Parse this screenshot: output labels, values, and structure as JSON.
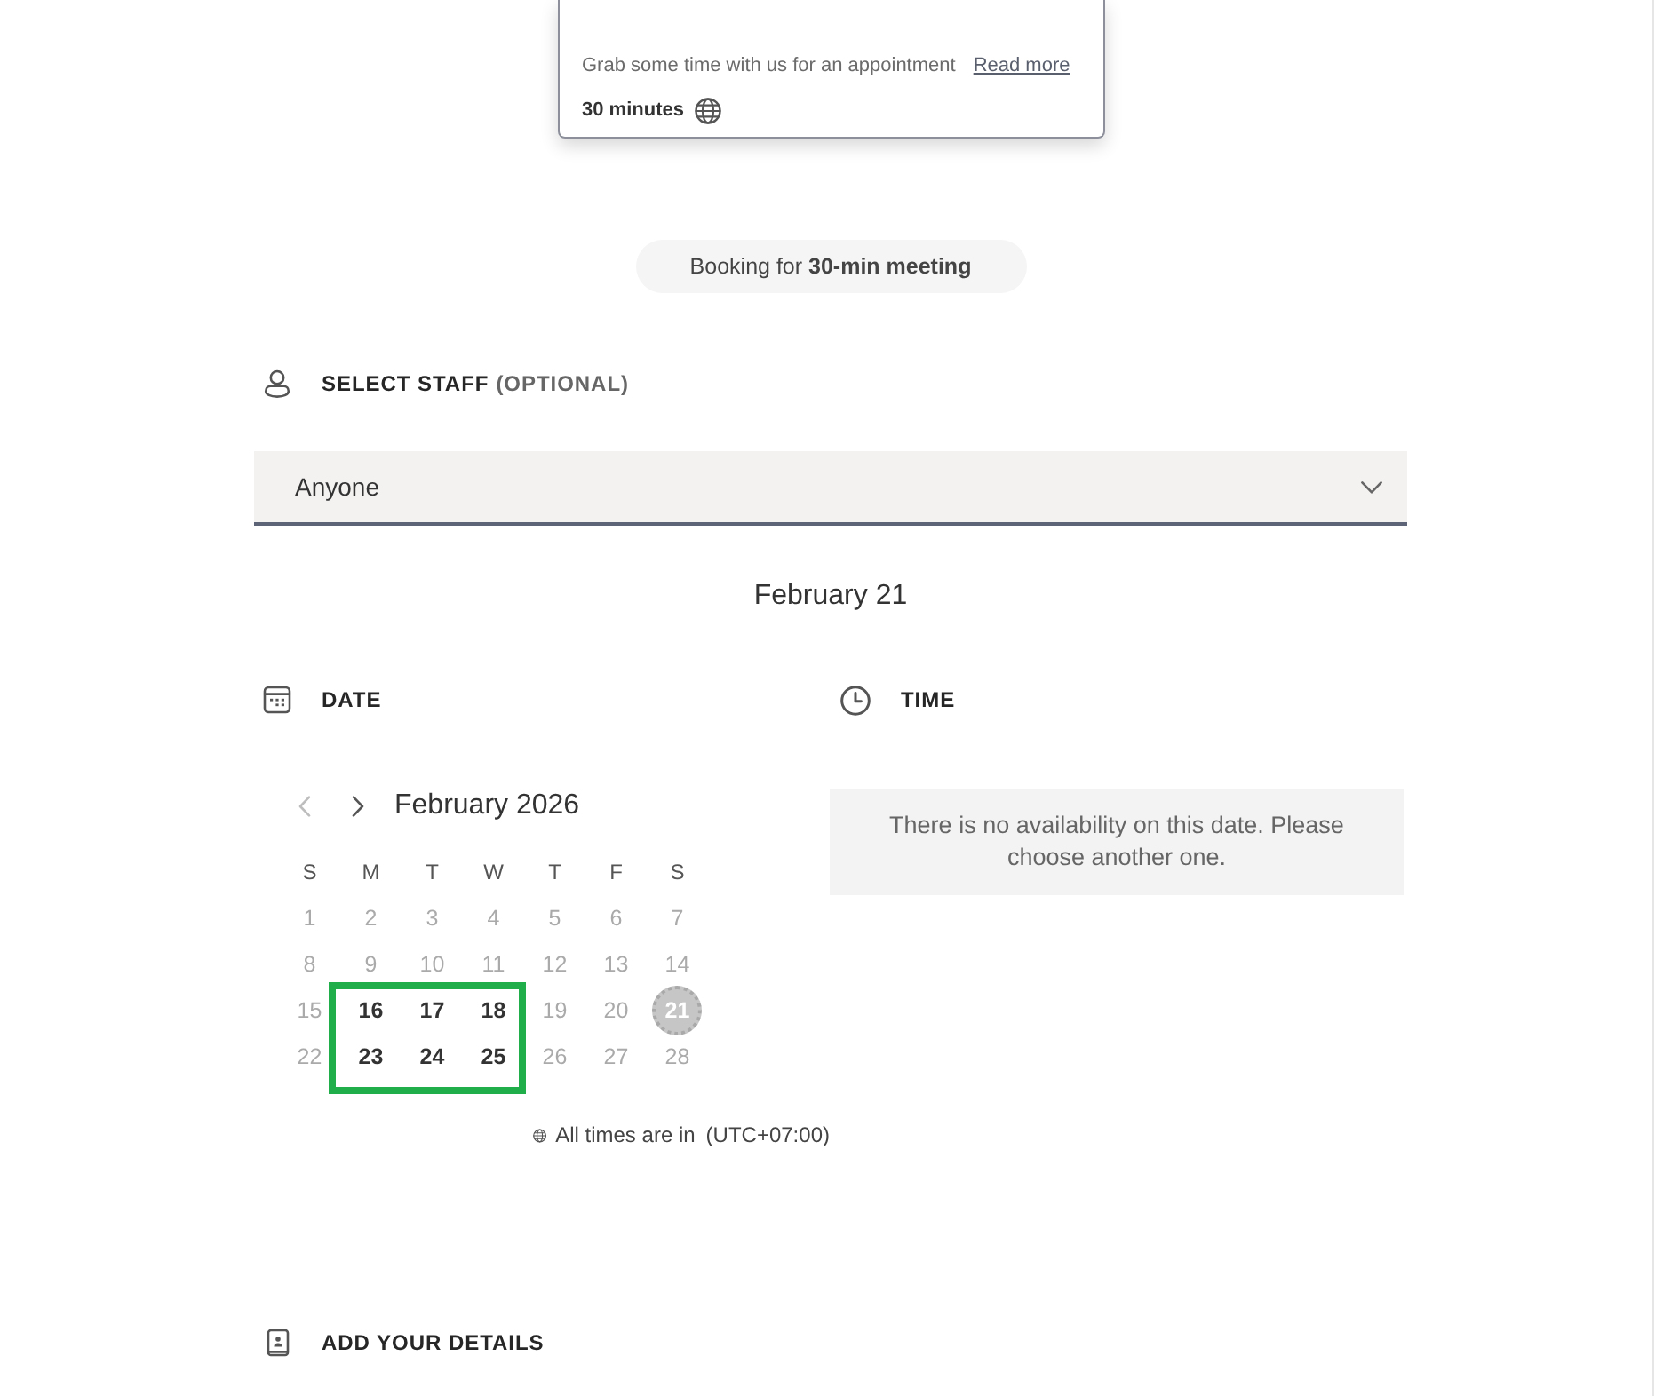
{
  "service_card": {
    "description": "Grab some time with us for an appointment",
    "link": "Read more",
    "duration": "30 minutes"
  },
  "booking_banner": "Booking for **30-min meeting**",
  "staff": {
    "title": "SELECT STAFF",
    "note": "(OPTIONAL)",
    "value": "Anyone"
  },
  "selected_date_heading": "February 21",
  "date": {
    "title": "DATE",
    "nav": [
      {
        "kind": "prev",
        "disabled": true
      },
      {
        "kind": "next",
        "disabled": false
      }
    ],
    "month": "February 2026",
    "weekdays": [
      "S",
      "M",
      "T",
      "W",
      "T",
      "F",
      "S"
    ],
    "weeks": [
      [
        {
          "label": "1",
          "available": false,
          "selected": false
        },
        {
          "label": "2",
          "available": false,
          "selected": false
        },
        {
          "label": "3",
          "available": false,
          "selected": false
        },
        {
          "label": "4",
          "available": false,
          "selected": false
        },
        {
          "label": "5",
          "available": false,
          "selected": false
        },
        {
          "label": "6",
          "available": false,
          "selected": false
        },
        {
          "label": "7",
          "available": false,
          "selected": false
        }
      ],
      [
        {
          "label": "8",
          "available": false,
          "selected": false
        },
        {
          "label": "9",
          "available": false,
          "selected": false
        },
        {
          "label": "10",
          "available": false,
          "selected": false
        },
        {
          "label": "11",
          "available": false,
          "selected": false
        },
        {
          "label": "12",
          "available": false,
          "selected": false
        },
        {
          "label": "13",
          "available": false,
          "selected": false
        },
        {
          "label": "14",
          "available": false,
          "selected": false
        }
      ],
      [
        {
          "label": "15",
          "available": false,
          "selected": false
        },
        {
          "label": "16",
          "available": true,
          "selected": false
        },
        {
          "label": "17",
          "available": true,
          "selected": false
        },
        {
          "label": "18",
          "available": true,
          "selected": false
        },
        {
          "label": "19",
          "available": false,
          "selected": false
        },
        {
          "label": "20",
          "available": false,
          "selected": false
        },
        {
          "label": "21",
          "available": false,
          "selected": true
        }
      ],
      [
        {
          "label": "22",
          "available": false,
          "selected": false
        },
        {
          "label": "23",
          "available": true,
          "selected": false
        },
        {
          "label": "24",
          "available": true,
          "selected": false
        },
        {
          "label": "25",
          "available": true,
          "selected": false
        },
        {
          "label": "26",
          "available": false,
          "selected": false
        },
        {
          "label": "27",
          "available": false,
          "selected": false
        },
        {
          "label": "28",
          "available": false,
          "selected": false
        }
      ]
    ],
    "timezone_label": "All times are in",
    "timezone": "(UTC+07:00)"
  },
  "time": {
    "title": "TIME",
    "message": "There is no availability on this date. Please choose another one."
  },
  "details": {
    "title": "ADD YOUR DETAILS"
  }
}
